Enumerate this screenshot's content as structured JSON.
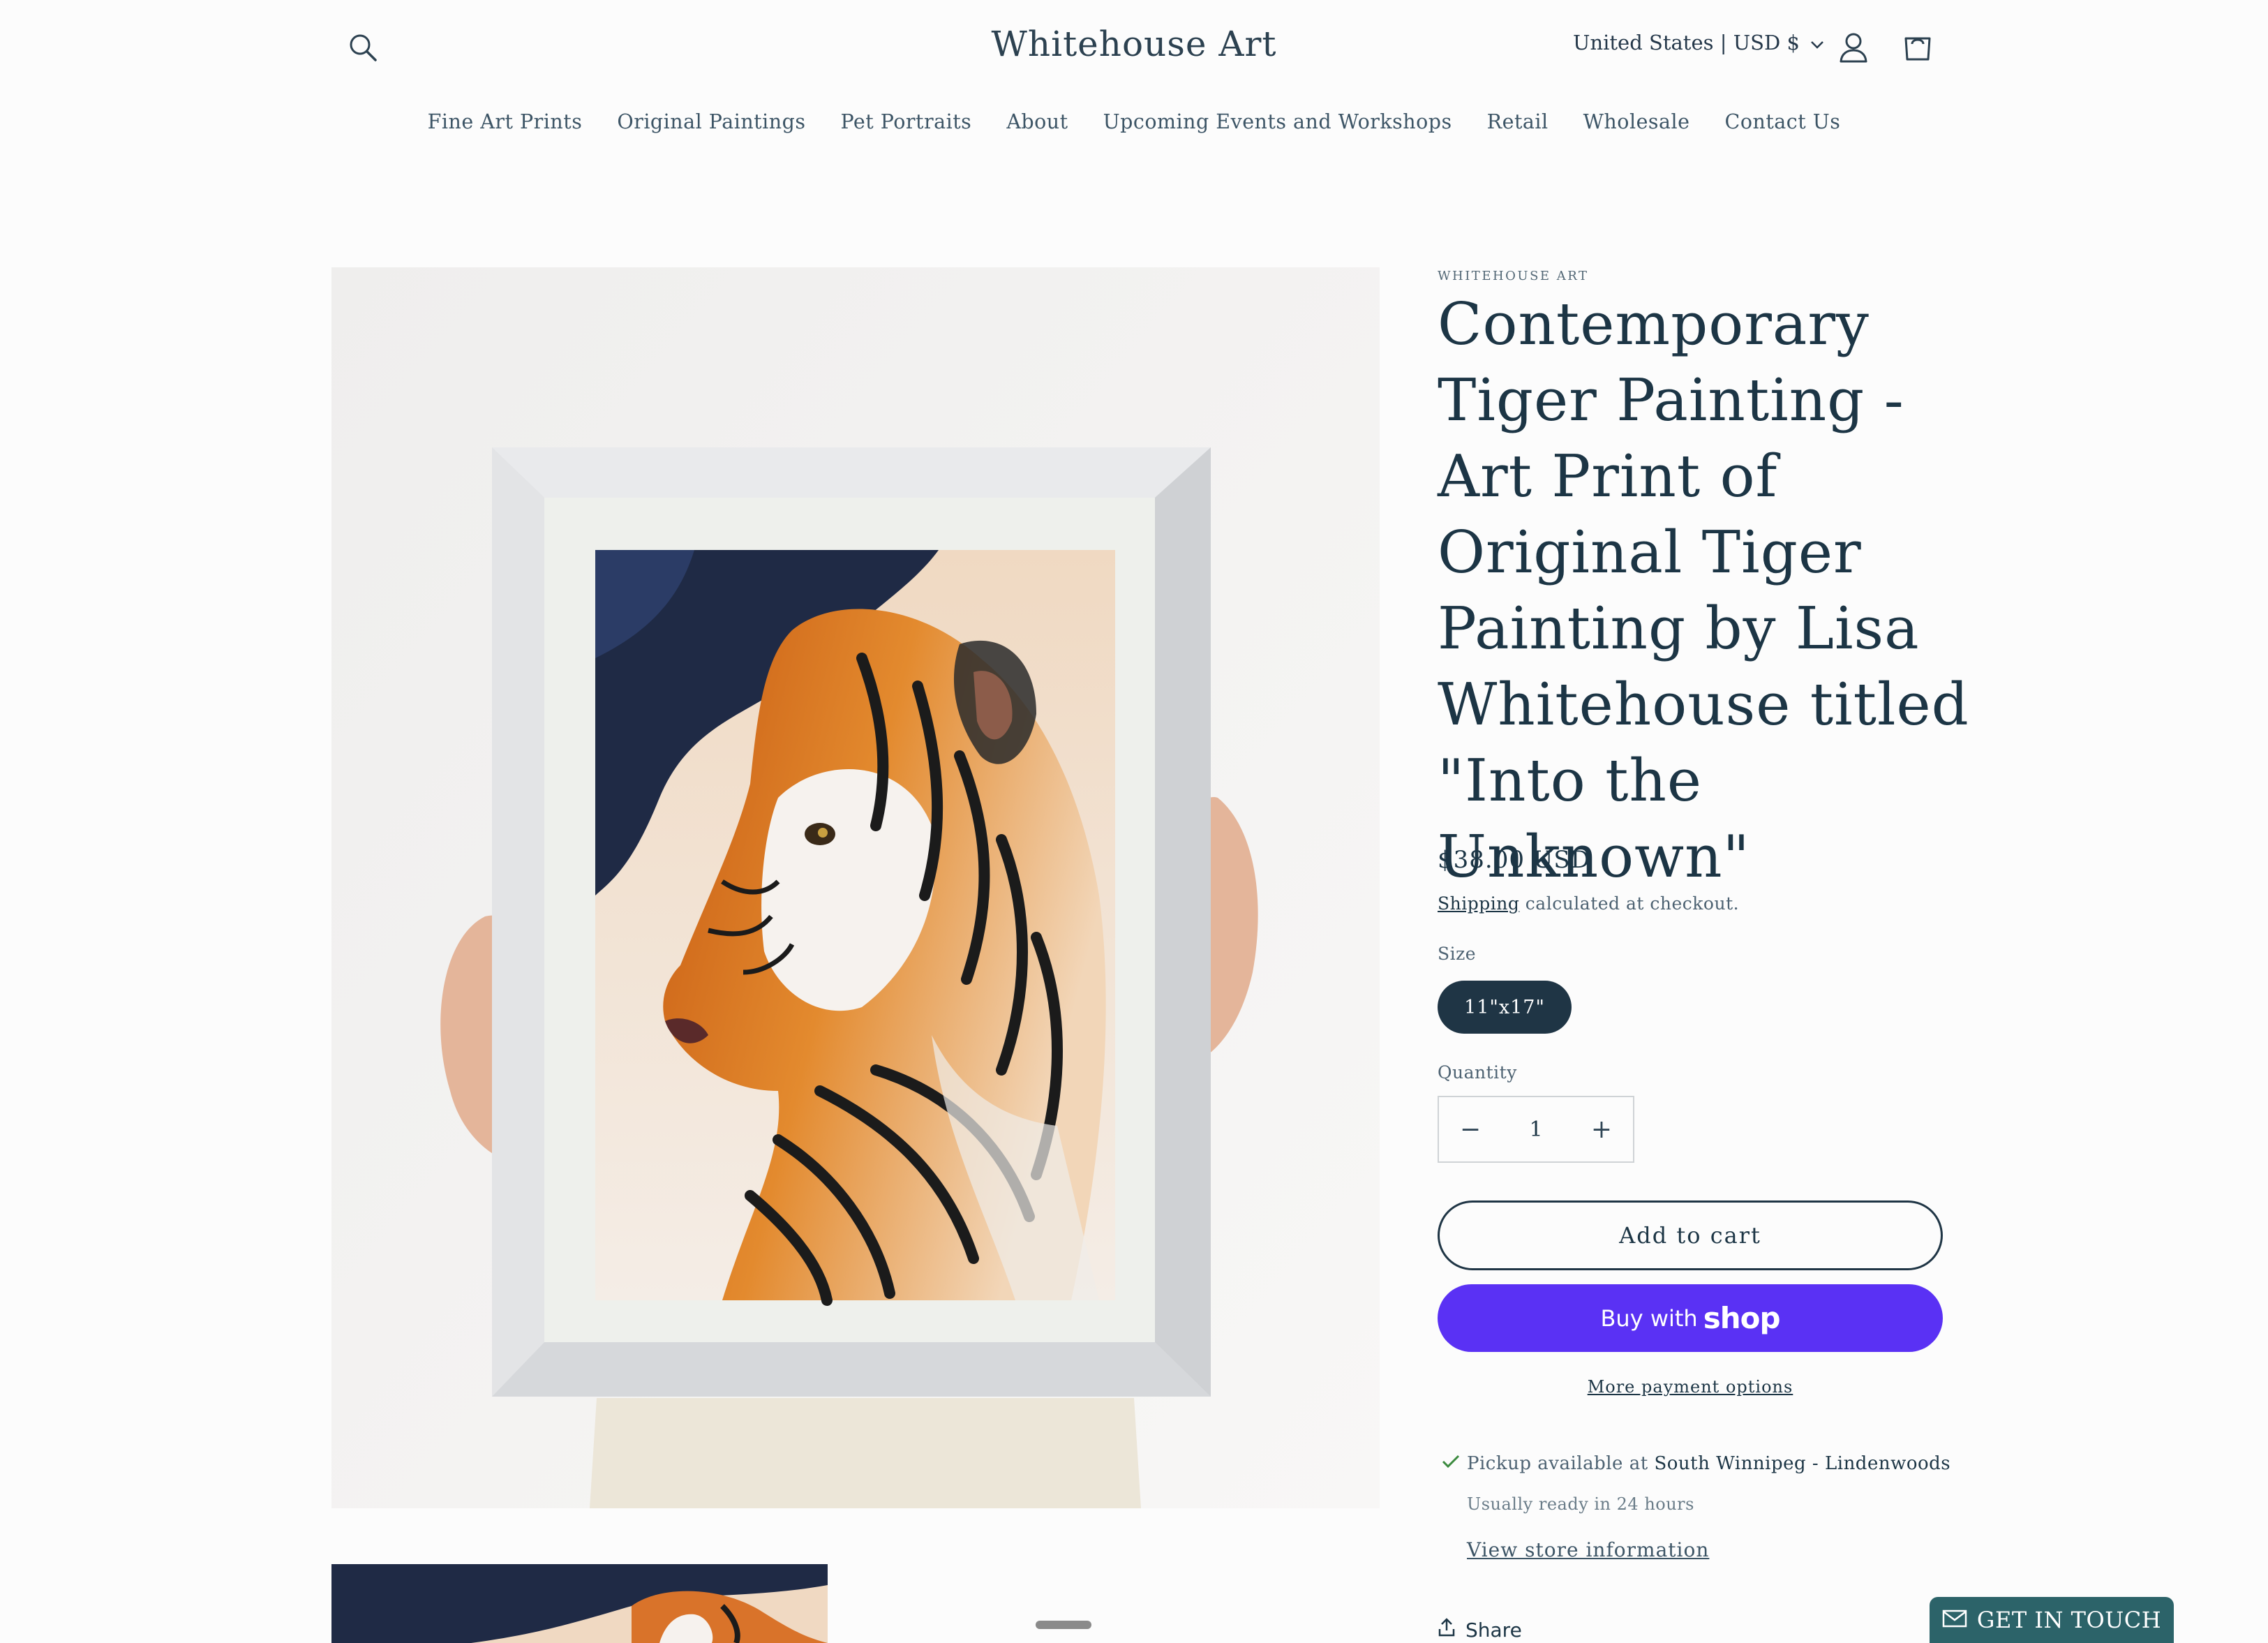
{
  "header": {
    "store_name": "Whitehouse Art",
    "country_selector": "United States | USD $",
    "icons": [
      "search-icon",
      "account-icon",
      "cart-icon",
      "chevron-down-icon"
    ]
  },
  "nav": {
    "items": [
      {
        "label": "Fine Art Prints"
      },
      {
        "label": "Original Paintings"
      },
      {
        "label": "Pet Portraits"
      },
      {
        "label": "About"
      },
      {
        "label": "Upcoming Events and Workshops"
      },
      {
        "label": "Retail"
      },
      {
        "label": "Wholesale"
      },
      {
        "label": "Contact Us"
      }
    ]
  },
  "product": {
    "vendor": "WHITEHOUSE ART",
    "title": "Contemporary Tiger Painting - Art Print of Original Tiger Painting by Lisa Whitehouse titled \"Into the Unknown\"",
    "price": "$38.00 USD",
    "shipping_link": "Shipping",
    "shipping_note": " calculated at checkout.",
    "size_label": "Size",
    "size_selected": "11\"x17\"",
    "quantity_label": "Quantity",
    "quantity_value": "1",
    "add_to_cart": "Add to cart",
    "buy_with": "Buy with",
    "buy_brand": "shop",
    "more_payment": "More payment options"
  },
  "pickup": {
    "prefix": "Pickup available at ",
    "location": "South Winnipeg - Lindenwoods",
    "ready": "Usually ready in 24 hours",
    "store_info": "View store information"
  },
  "share_label": "Share",
  "contact_widget": "GET IN TOUCH",
  "colors": {
    "primary": "#1f3545",
    "shop_pay": "#5a31f4",
    "widget": "#2c6369",
    "pickup_check": "#3b8a3e"
  }
}
